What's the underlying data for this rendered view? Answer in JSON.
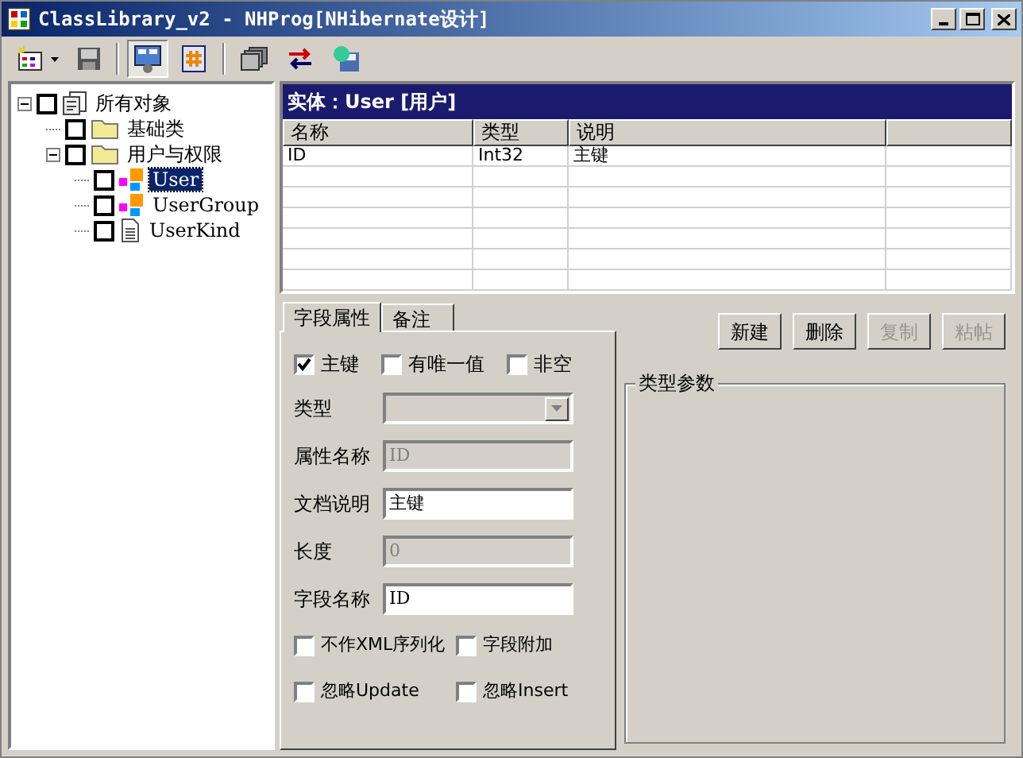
{
  "window": {
    "title": "ClassLibrary_v2 - NHProg[NHibernate设计]"
  },
  "toolbar": [
    {
      "kind": "grid",
      "selected": false
    },
    {
      "kind": "save",
      "selected": false
    },
    {
      "kind": "form",
      "selected": true
    },
    {
      "kind": "hash",
      "selected": false
    },
    {
      "kind": "stack",
      "selected": false
    },
    {
      "kind": "swap",
      "selected": false
    },
    {
      "kind": "disk",
      "selected": false
    }
  ],
  "tree": [
    {
      "label": "所有对象",
      "kind": "root",
      "checked": false,
      "expanded": true,
      "selected": false,
      "children": [
        {
          "label": "基础类",
          "kind": "folder",
          "checked": false,
          "selected": false
        },
        {
          "label": "用户与权限",
          "kind": "folder",
          "checked": false,
          "expanded": true,
          "selected": false,
          "children": [
            {
              "label": "User",
              "kind": "class",
              "checked": false,
              "selected": true
            },
            {
              "label": "UserGroup",
              "kind": "class",
              "checked": false,
              "selected": false
            },
            {
              "label": "UserKind",
              "kind": "enum",
              "checked": false,
              "selected": false
            }
          ]
        }
      ]
    }
  ],
  "entity": {
    "title": "实体：User [用户]",
    "columns": [
      "名称",
      "类型",
      "说明"
    ],
    "rows": [
      [
        "ID",
        "Int32",
        "主键"
      ]
    ]
  },
  "tabs": [
    {
      "label": "字段属性",
      "selected": true
    },
    {
      "label": "备注",
      "selected": false
    }
  ],
  "top_checks": [
    {
      "label": "主键",
      "checked": true
    },
    {
      "label": "有唯一值",
      "checked": false
    },
    {
      "label": "非空",
      "checked": false
    }
  ],
  "fields": [
    {
      "label": "类型",
      "kind": "select",
      "disabled": true
    },
    {
      "label": "属性名称",
      "kind": "text",
      "value": "ID",
      "disabled": true
    },
    {
      "label": "文档说明",
      "kind": "text",
      "value": "主键",
      "disabled": false
    },
    {
      "label": "长度",
      "kind": "text",
      "value": "0",
      "disabled": true
    },
    {
      "label": "字段名称",
      "kind": "text",
      "value": "ID",
      "disabled": false
    }
  ],
  "bottom_checks": [
    [
      {
        "label": "不作XML序列化",
        "checked": false
      },
      {
        "label": "字段附加",
        "checked": false
      }
    ],
    [
      {
        "label": "忽略Update",
        "checked": false
      },
      {
        "label": "忽略Insert",
        "checked": false
      }
    ]
  ],
  "buttons": [
    {
      "label": "新建",
      "disabled": false
    },
    {
      "label": "删除",
      "disabled": false
    },
    {
      "label": "复制",
      "disabled": true
    },
    {
      "label": "粘帖",
      "disabled": true
    }
  ],
  "group": {
    "title": "类型参数"
  }
}
